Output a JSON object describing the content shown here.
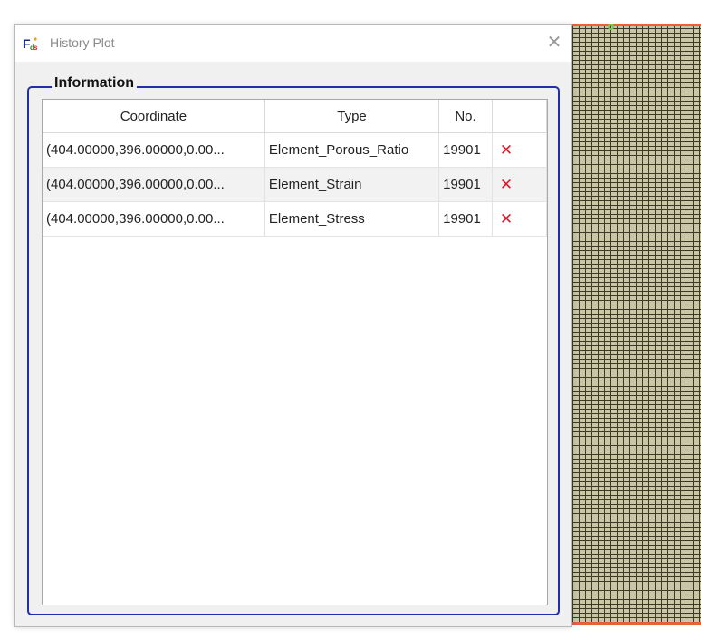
{
  "dialog": {
    "title": "History Plot",
    "app_icon": "fds-app-icon",
    "close_label": "✕"
  },
  "information": {
    "group_title": "Information",
    "columns": [
      "Coordinate",
      "Type",
      "No.",
      ""
    ],
    "rows": [
      {
        "coordinate": "(404.00000,396.00000,0.00...",
        "type": "Element_Porous_Ratio",
        "no": "19901",
        "delete": "✕"
      },
      {
        "coordinate": "(404.00000,396.00000,0.00...",
        "type": "Element_Strain",
        "no": "19901",
        "delete": "✕"
      },
      {
        "coordinate": "(404.00000,396.00000,0.00...",
        "type": "Element_Stress",
        "no": "19901",
        "delete": "✕"
      }
    ]
  },
  "colors": {
    "group_border": "#1f2fa8",
    "delete_icon": "#e0162b",
    "mesh_fill": "#c9c6a6",
    "mesh_edge": "#e8603c"
  }
}
